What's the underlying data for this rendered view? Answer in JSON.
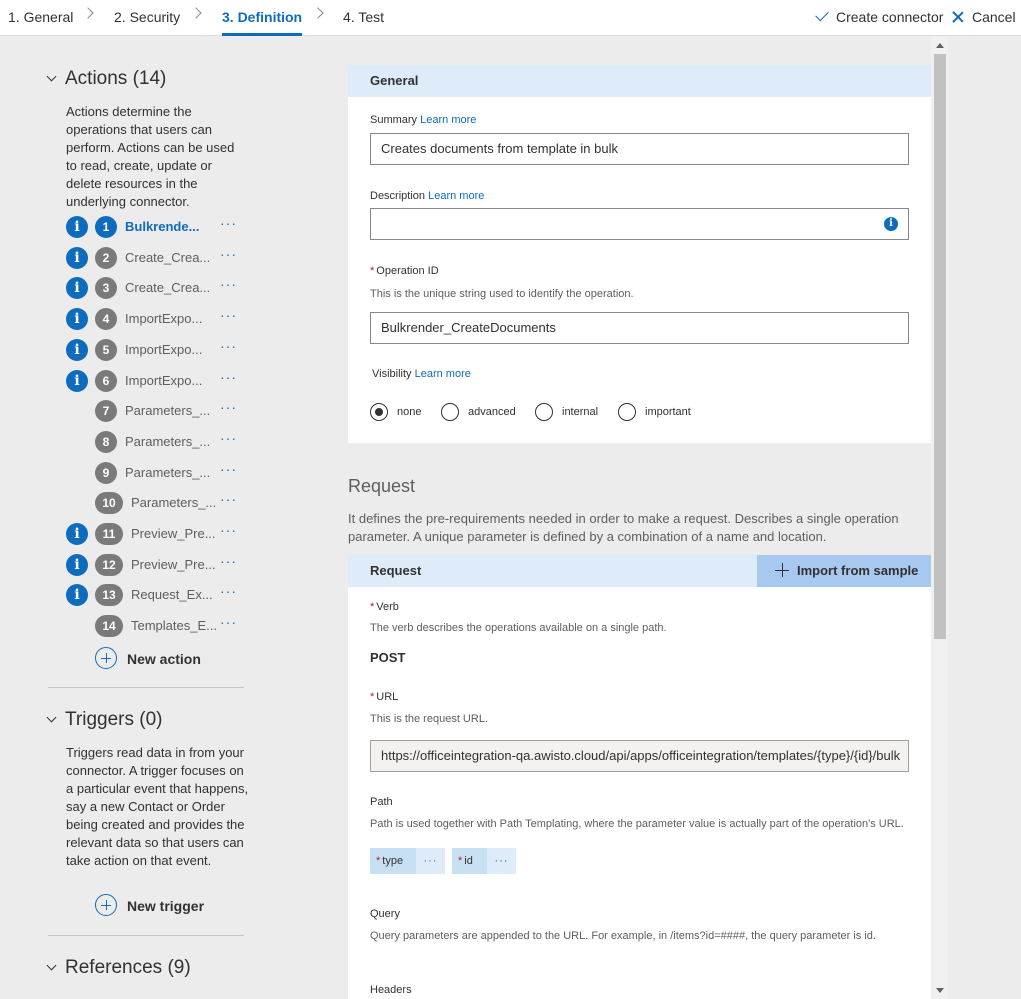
{
  "wizard": {
    "steps": [
      "1. General",
      "2. Security",
      "3. Definition",
      "4. Test"
    ],
    "create_label": "Create connector",
    "cancel_label": "Cancel"
  },
  "actions": {
    "title": "Actions (14)",
    "description": "Actions determine the operations that users can perform. Actions can be used to read, create, update or delete resources in the underlying connector.",
    "items": [
      {
        "num": "1",
        "label": "Bulkrende...",
        "info": true,
        "active": true
      },
      {
        "num": "2",
        "label": "Create_Crea...",
        "info": true
      },
      {
        "num": "3",
        "label": "Create_Crea...",
        "info": true
      },
      {
        "num": "4",
        "label": "ImportExpo...",
        "info": true
      },
      {
        "num": "5",
        "label": "ImportExpo...",
        "info": true
      },
      {
        "num": "6",
        "label": "ImportExpo...",
        "info": true
      },
      {
        "num": "7",
        "label": "Parameters_...",
        "info": false
      },
      {
        "num": "8",
        "label": "Parameters_...",
        "info": false
      },
      {
        "num": "9",
        "label": "Parameters_...",
        "info": false
      },
      {
        "num": "10",
        "label": "Parameters_...",
        "info": false
      },
      {
        "num": "11",
        "label": "Preview_Pre...",
        "info": true
      },
      {
        "num": "12",
        "label": "Preview_Pre...",
        "info": true
      },
      {
        "num": "13",
        "label": "Request_Ex...",
        "info": true
      },
      {
        "num": "14",
        "label": "Templates_E...",
        "info": false
      }
    ],
    "more_label": "···",
    "new_label": "New action"
  },
  "triggers": {
    "title": "Triggers (0)",
    "description": "Triggers read data in from your connector. A trigger focuses on a particular event that happens, say a new Contact or Order being created and provides the relevant data so that users can take action on that event.",
    "new_label": "New trigger"
  },
  "references": {
    "title": "References (9)"
  },
  "general": {
    "header": "General",
    "summary_label": "Summary",
    "learn_more": "Learn more",
    "summary_value": "Creates documents from template in bulk",
    "description_label": "Description",
    "description_value": "",
    "operation_id_label": "Operation ID",
    "operation_id_hint": "This is the unique string used to identify the operation.",
    "operation_id_value": "Bulkrender_CreateDocuments",
    "visibility_label": "Visibility",
    "visibility_options": [
      "none",
      "advanced",
      "internal",
      "important"
    ],
    "visibility_selected": "none"
  },
  "request": {
    "title": "Request",
    "description": "It defines the pre-requirements needed in order to make a request. Describes a single operation parameter. A unique parameter is defined by a combination of a name and location.",
    "header": "Request",
    "import_label": "Import from sample",
    "verb_label": "Verb",
    "verb_hint": "The verb describes the operations available on a single path.",
    "verb_value": "POST",
    "url_label": "URL",
    "url_hint": "This is the request URL.",
    "url_value": "https://officeintegration-qa.awisto.cloud/api/apps/officeintegration/templates/{type}/{id}/bulk",
    "path_label": "Path",
    "path_hint": "Path is used together with Path Templating, where the parameter value is actually part of the operation's URL.",
    "path_params": [
      "type",
      "id"
    ],
    "query_label": "Query",
    "query_hint": "Query parameters are appended to the URL. For example, in /items?id=####, the query parameter is id.",
    "headers_label": "Headers"
  },
  "colors": {
    "accent": "#0f6cbd",
    "header_bg": "#deecf9",
    "import_bg": "#a7c8ef",
    "required": "#a4262c"
  }
}
